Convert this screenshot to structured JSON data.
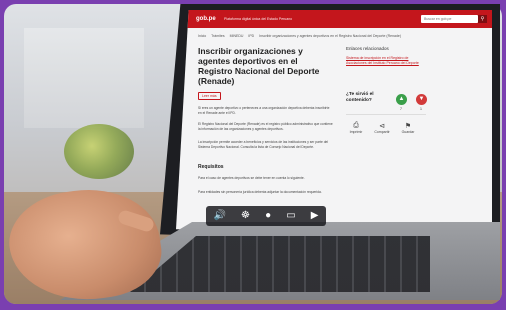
{
  "site": {
    "logo": "gob.pe",
    "topbar_text": "Plataforma digital única del Estado Peruano",
    "search_placeholder": "Buscar en gob.pe",
    "search_icon": "search-icon"
  },
  "breadcrumb": [
    "Inicio",
    "Trámites",
    "MINEDU",
    "IPD",
    "Inscribir organizaciones y agentes deportivos en el Registro Nacional del Deporte (Renade)"
  ],
  "page": {
    "title": "Inscribir organizaciones y agentes deportivos en el Registro Nacional del Deporte (Renade)",
    "read_more": "Leer más",
    "paragraphs": [
      "Si eres un agente deportivo o perteneces a una organización deportiva deberás inscribirte en el Renade ante el IPD.",
      "El Registro Nacional del Deporte (Renade) es el registro público administrativo que contiene la información de las organizaciones y agentes deportivos.",
      "La inscripción permite acceder a beneficios y servicios de las instituciones y ser parte del Sistema Deportivo Nacional. Consulta la lista de Consejo Nacional del Deporte."
    ],
    "subheading": "Requisitos",
    "req_paragraphs": [
      "Para el caso de agentes deportivos se debe tener en cuenta lo siguiente.",
      "Para entidades sin personería jurídica deberás adjuntar la documentación requerida."
    ]
  },
  "sidebar": {
    "related_title": "Enlaces relacionados",
    "related_link": "Sistema de inscripción en el Registro de Asociaciones del Instituto Peruano del Deporte",
    "feedback_question": "¿Te sirvió el contenido?",
    "vote_up_count": "7",
    "vote_down_count": "1",
    "actions": [
      {
        "label": "Imprimir",
        "icon": "printer-icon"
      },
      {
        "label": "Compartir",
        "icon": "share-icon"
      },
      {
        "label": "Guardar",
        "icon": "bookmark-icon"
      }
    ]
  },
  "accessibility_bar": {
    "icons": [
      "audio-icon",
      "hearing-icon",
      "user-icon",
      "screen-icon",
      "video-icon"
    ]
  },
  "colors": {
    "brand": "#c4161c",
    "vote_up": "#3a9f4a",
    "vote_down": "#d23a3a",
    "frame": "#7a3fb0"
  }
}
